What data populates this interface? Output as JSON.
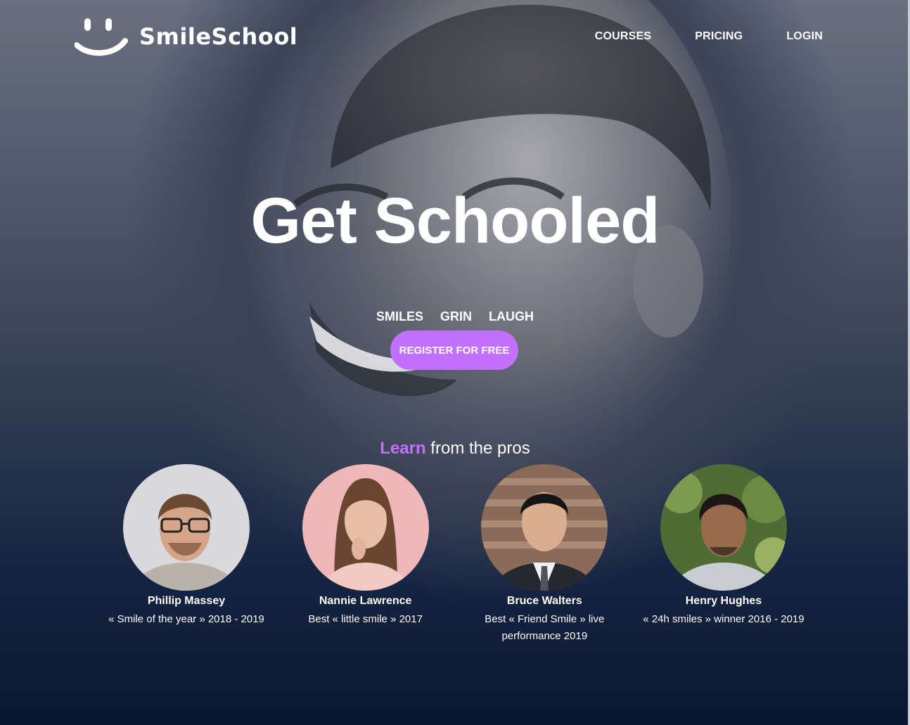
{
  "brand": {
    "name": "SmileSchool",
    "logo_icon": "smiley-icon"
  },
  "nav": {
    "courses": "COURSES",
    "pricing": "PRICING",
    "login": "LOGIN"
  },
  "hero": {
    "title": "Get Schooled",
    "tags": [
      "SMILES",
      "GRIN",
      "LAUGH"
    ],
    "cta": "REGISTER FOR FREE"
  },
  "pros": {
    "heading_accent": "Learn",
    "heading_rest": " from the pros",
    "items": [
      {
        "name": "Phillip Massey",
        "desc": "« Smile of the year » 2018 - 2019"
      },
      {
        "name": "Nannie Lawrence",
        "desc": "Best « little smile » 2017"
      },
      {
        "name": "Bruce Walters",
        "desc": "Best « Friend Smile » live performance 2019"
      },
      {
        "name": "Henry Hughes",
        "desc": "« 24h smiles » winner 2016 - 2019"
      }
    ]
  },
  "colors": {
    "accent": "#c271ff",
    "background_dark": "#0b1730",
    "text": "#ffffff"
  }
}
